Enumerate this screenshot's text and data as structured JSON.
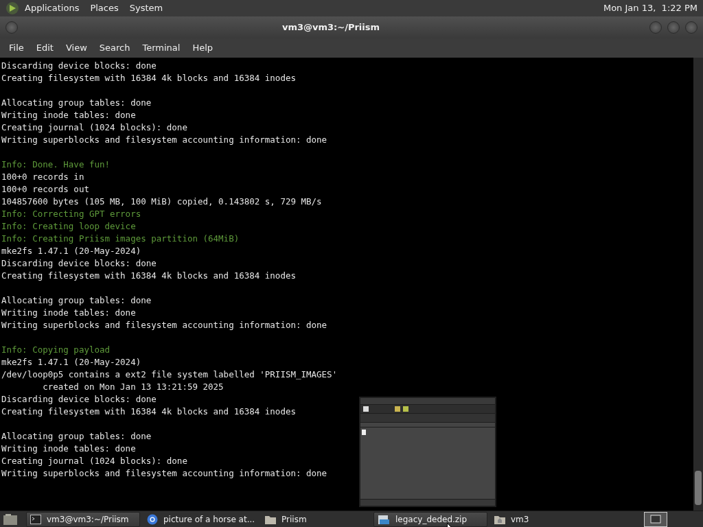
{
  "top_panel": {
    "menus": [
      "Applications",
      "Places",
      "System"
    ],
    "clock": "Mon Jan 13,  1:22 PM"
  },
  "window": {
    "title": "vm3@vm3:~/Priism"
  },
  "menubar": [
    "File",
    "Edit",
    "View",
    "Search",
    "Terminal",
    "Help"
  ],
  "terminal_lines": [
    {
      "kind": "output",
      "text": "Discarding device blocks: done"
    },
    {
      "kind": "output",
      "text": "Creating filesystem with 16384 4k blocks and 16384 inodes"
    },
    {
      "kind": "blank"
    },
    {
      "kind": "output",
      "text": "Allocating group tables: done"
    },
    {
      "kind": "output",
      "text": "Writing inode tables: done"
    },
    {
      "kind": "output",
      "text": "Creating journal (1024 blocks): done"
    },
    {
      "kind": "output",
      "text": "Writing superblocks and filesystem accounting information: done"
    },
    {
      "kind": "blank"
    },
    {
      "kind": "info",
      "text": "Info: Done. Have fun!"
    },
    {
      "kind": "output",
      "text": "100+0 records in"
    },
    {
      "kind": "output",
      "text": "100+0 records out"
    },
    {
      "kind": "output",
      "text": "104857600 bytes (105 MB, 100 MiB) copied, 0.143802 s, 729 MB/s"
    },
    {
      "kind": "info",
      "text": "Info: Correcting GPT errors"
    },
    {
      "kind": "info",
      "text": "Info: Creating loop device"
    },
    {
      "kind": "info",
      "text": "Info: Creating Priism images partition (64MiB)"
    },
    {
      "kind": "output",
      "text": "mke2fs 1.47.1 (20-May-2024)"
    },
    {
      "kind": "output",
      "text": "Discarding device blocks: done"
    },
    {
      "kind": "output",
      "text": "Creating filesystem with 16384 4k blocks and 16384 inodes"
    },
    {
      "kind": "blank"
    },
    {
      "kind": "output",
      "text": "Allocating group tables: done"
    },
    {
      "kind": "output",
      "text": "Writing inode tables: done"
    },
    {
      "kind": "output",
      "text": "Writing superblocks and filesystem accounting information: done"
    },
    {
      "kind": "blank"
    },
    {
      "kind": "info",
      "text": "Info: Copying payload"
    },
    {
      "kind": "output",
      "text": "mke2fs 1.47.1 (20-May-2024)"
    },
    {
      "kind": "output",
      "text": "/dev/loop0p5 contains a ext2 file system labelled 'PRIISM_IMAGES'"
    },
    {
      "kind": "output",
      "text": "        created on Mon Jan 13 13:21:59 2025"
    },
    {
      "kind": "output",
      "text": "Discarding device blocks: done"
    },
    {
      "kind": "output",
      "text": "Creating filesystem with 16384 4k blocks and 16384 inodes"
    },
    {
      "kind": "blank"
    },
    {
      "kind": "output",
      "text": "Allocating group tables: done"
    },
    {
      "kind": "output",
      "text": "Writing inode tables: done"
    },
    {
      "kind": "output",
      "text": "Creating journal (1024 blocks): done"
    },
    {
      "kind": "output",
      "text": "Writing superblocks and filesystem accounting information: done"
    }
  ],
  "taskbar": [
    {
      "kind": "terminal",
      "label": "vm3@vm3:~/Priism",
      "active": true
    },
    {
      "kind": "browser",
      "label": "picture of a horse at...",
      "active": false
    },
    {
      "kind": "folder",
      "label": "Priism",
      "active": false
    },
    {
      "kind": "archive",
      "label": "legacy_deded.zip",
      "active": true
    },
    {
      "kind": "home",
      "label": "vm3",
      "active": false
    }
  ]
}
